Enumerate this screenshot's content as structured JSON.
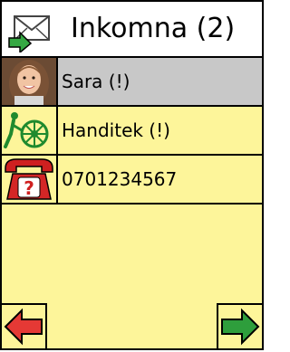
{
  "header": {
    "icon": "mail-inbox-icon",
    "title": "Inkomna (2)"
  },
  "items": [
    {
      "label": "Sara (!)",
      "icon": "contact-photo-girl"
    },
    {
      "label": "Handitek (!)",
      "icon": "wheelchair-logo-icon"
    },
    {
      "label": "0701234567",
      "icon": "unknown-caller-phone-icon"
    }
  ],
  "navigation": {
    "prev": "arrow-left-icon",
    "next": "arrow-right-icon"
  },
  "colors": {
    "list_bg": "#fdf59a",
    "selected_bg": "#c8c8c8",
    "prev_arrow": "#e53935",
    "next_arrow": "#2e9e3c"
  }
}
